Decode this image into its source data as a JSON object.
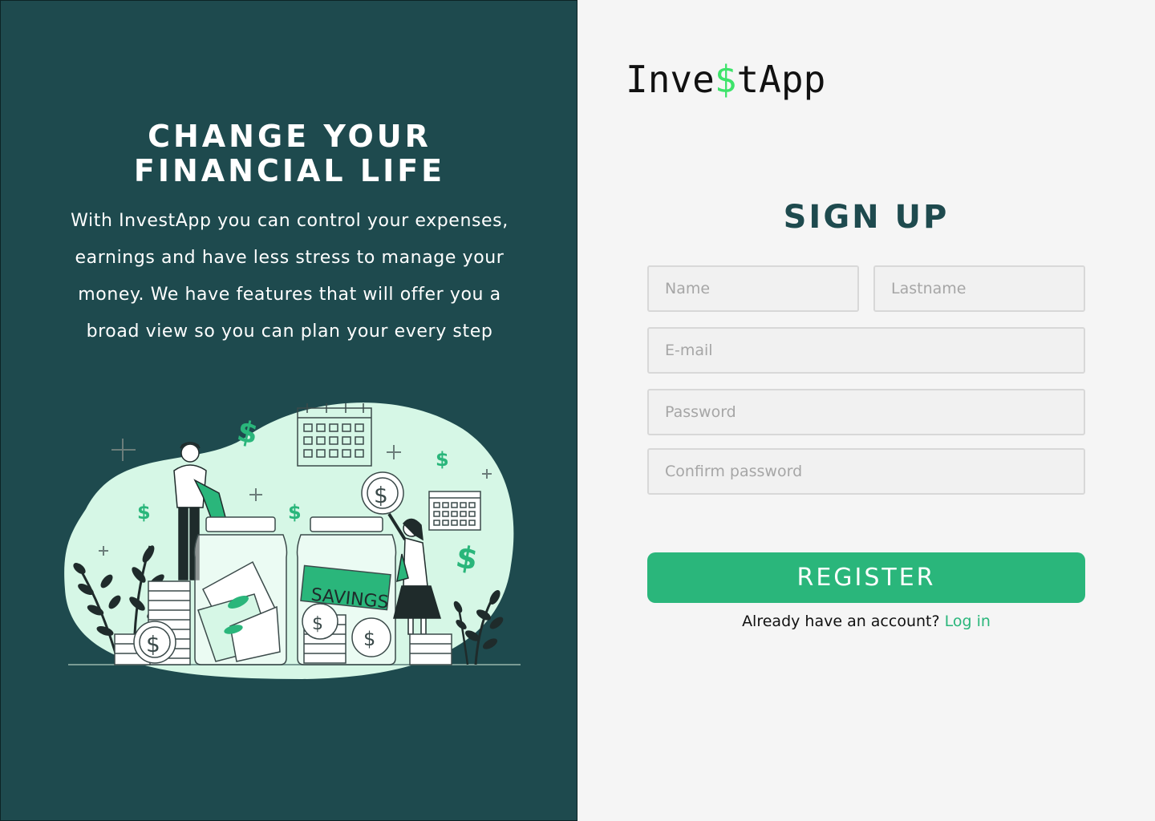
{
  "hero": {
    "title_line1": "CHANGE YOUR",
    "title_line2": "FINANCIAL LIFE",
    "description": "With InvestApp you can control your expenses, earnings and have less stress to manage your money. We have features that will offer you a broad view so you can plan your every step",
    "illustration": {
      "icon": "savings-illustration",
      "jar_label": "SAVINGS",
      "coin_symbol": "$"
    }
  },
  "logo": {
    "before": "Inve",
    "symbol": "$",
    "after": "tApp"
  },
  "form": {
    "title": "SIGN UP",
    "name_placeholder": "Name",
    "lastname_placeholder": "Lastname",
    "email_placeholder": "E-mail",
    "password_placeholder": "Password",
    "confirm_placeholder": "Confirm password",
    "register_label": "REGISTER",
    "login_prompt": "Already have an account?",
    "login_link": "Log in"
  },
  "colors": {
    "panel_bg": "#1e4a4e",
    "accent": "#2ab67b",
    "logo_dollar": "#3de36a",
    "illustration_blob": "#d6f7e6"
  }
}
